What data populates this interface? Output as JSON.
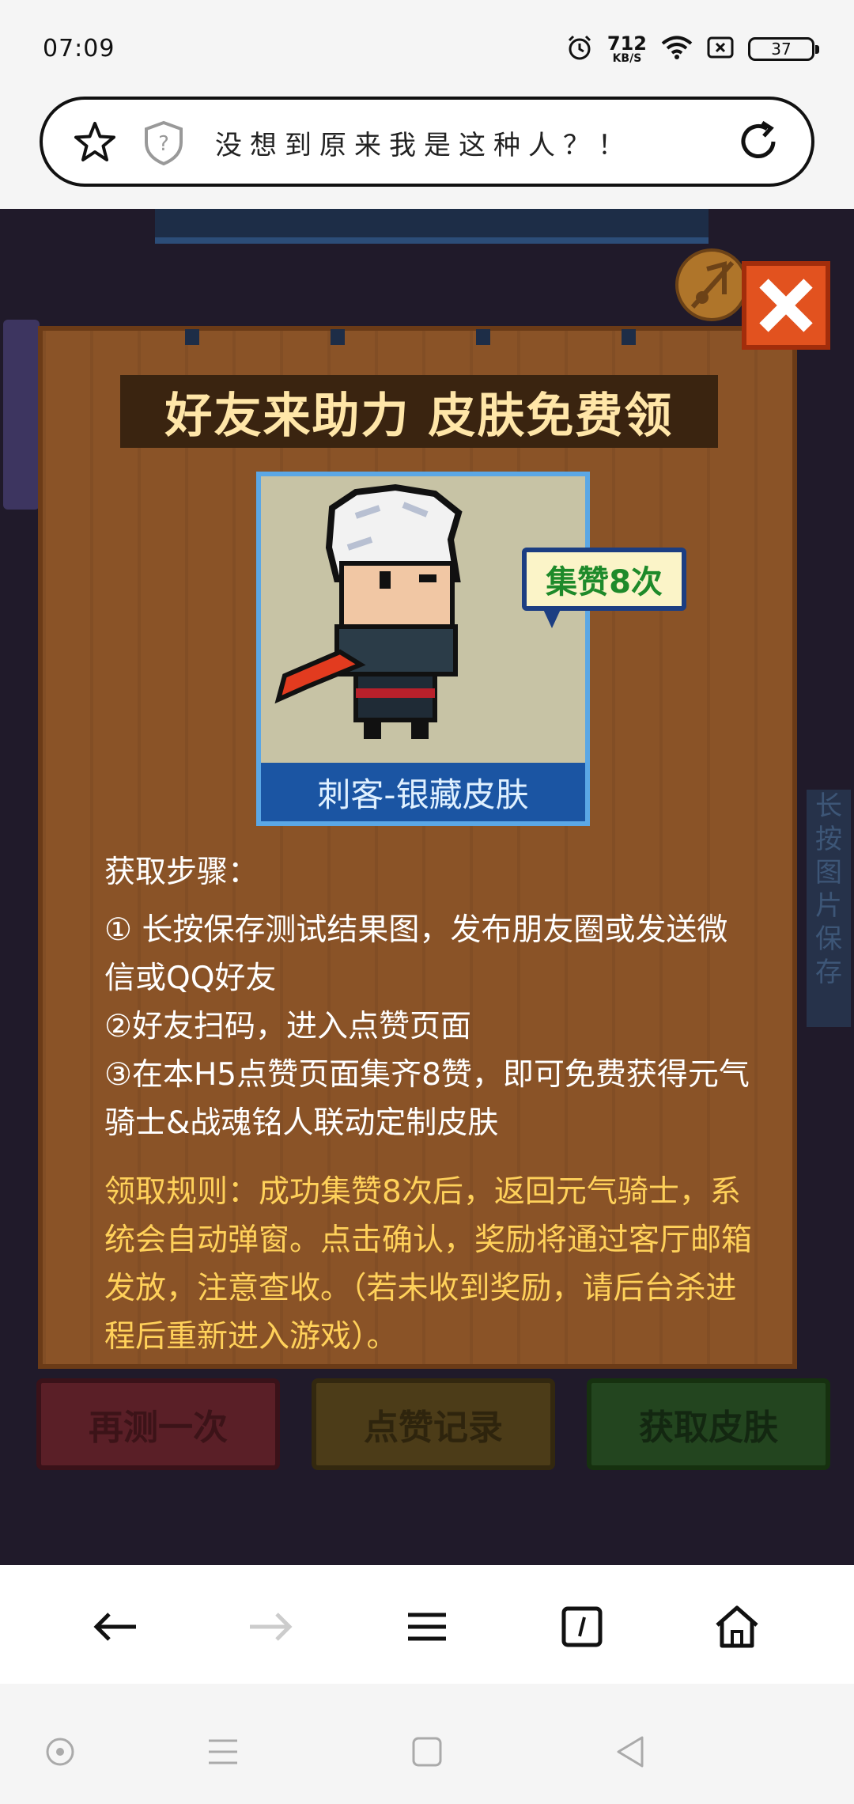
{
  "status_bar": {
    "time": "07:09",
    "net_speed": "712",
    "net_unit": "KB/S",
    "battery": "37"
  },
  "address_bar": {
    "page_title": "没想到原来我是这种人？！"
  },
  "game": {
    "side_text_right": [
      "长",
      "按",
      "图",
      "片",
      "保",
      "存"
    ],
    "panel_title": "好友来助力 皮肤免费领",
    "card_caption": "刺客-银藏皮肤",
    "bubble_text": "集赞8次",
    "steps_heading": "获取步骤：",
    "steps": [
      "① 长按保存测试结果图，发布朋友圈或发送微信或QQ好友",
      "②好友扫码，进入点赞页面",
      "③在本H5点赞页面集齐8赞，即可免费获得元气骑士&战魂铭人联动定制皮肤"
    ],
    "rules": "领取规则：成功集赞8次后，返回元气骑士，系统会自动弹窗。点击确认，奖励将通过客厅邮箱发放，注意查收。（若未收到奖励，请后台杀进程后重新进入游戏）。",
    "buttons": {
      "retry": "再测一次",
      "likes": "点赞记录",
      "get_skin": "获取皮肤"
    }
  },
  "colors": {
    "panel_wood": "#8a5327",
    "title_text": "#ffe6a8",
    "rules_text": "#ffd15a",
    "caption_bg": "#1b55a3",
    "close_red": "#e2521f"
  },
  "icons": {
    "address": [
      "star-icon",
      "shield-question-icon",
      "reload-icon"
    ],
    "browser_nav": [
      "back-arrow-icon",
      "forward-arrow-icon",
      "menu-icon",
      "tabs-icon",
      "home-icon"
    ],
    "system_nav": [
      "circle-icon",
      "recents-icon",
      "square-icon",
      "back-triangle-icon"
    ]
  }
}
